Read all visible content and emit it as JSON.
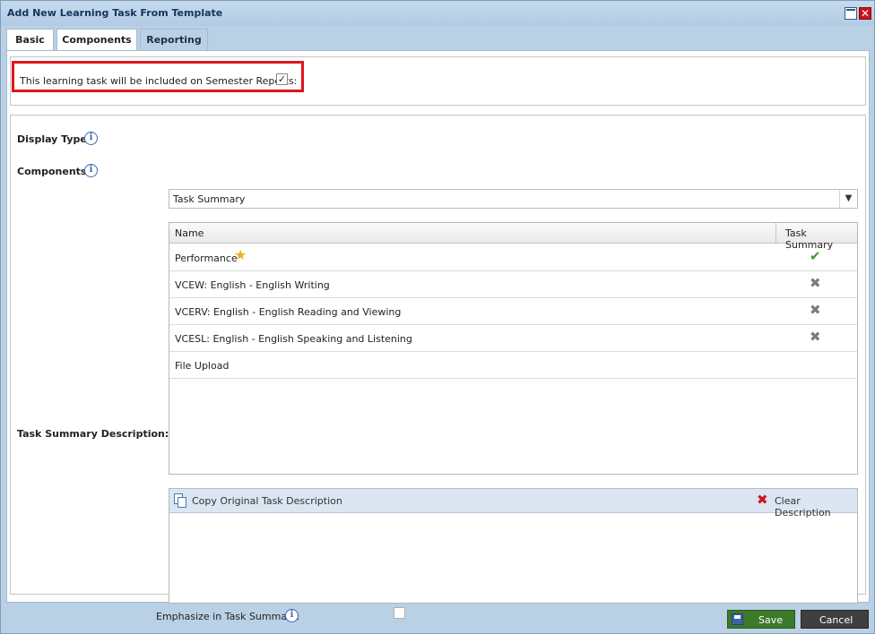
{
  "window": {
    "title": "Add New Learning Task From Template"
  },
  "tabs": [
    {
      "label": "Basic"
    },
    {
      "label": "Components"
    },
    {
      "label": "Reporting"
    }
  ],
  "reporting": {
    "include_label": "This learning task will be included on Semester Reports:",
    "include_checked": true
  },
  "form": {
    "display_type_label": "Display Type:",
    "display_type_value": "Task Summary",
    "components_label": "Components:",
    "task_summary_description_label": "Task Summary Description:",
    "emphasize_label": "Emphasize in Task Summary:",
    "emphasize_checked": false
  },
  "grid": {
    "columns": [
      "Name",
      "Task Summary"
    ],
    "rows": [
      {
        "name": "Performance",
        "starred": true,
        "summary": "tick"
      },
      {
        "name": "VCEW: English - English Writing",
        "starred": false,
        "summary": "cross"
      },
      {
        "name": "VCERV: English - English Reading and Viewing",
        "starred": false,
        "summary": "cross"
      },
      {
        "name": "VCESL: English - English Speaking and Listening",
        "starred": false,
        "summary": "cross"
      },
      {
        "name": "File Upload",
        "starred": false,
        "summary": ""
      }
    ]
  },
  "editor": {
    "copy_label": "Copy Original Task Description",
    "clear_label": "Clear Description"
  },
  "buttons": {
    "save_label": "Save",
    "cancel_label": "Cancel"
  },
  "colors": {
    "highlight": "#e0151b",
    "save_button": "#3c7a2a",
    "cancel_button": "#3f3f3f",
    "tick": "#3d9b2d"
  },
  "icons": {
    "info": "info-icon",
    "star": "star-icon",
    "tick": "check-icon",
    "cross": "x-icon"
  }
}
